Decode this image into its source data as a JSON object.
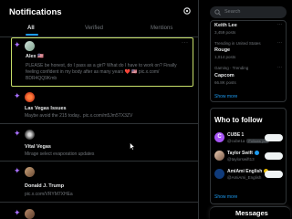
{
  "header": {
    "title": "Notifications"
  },
  "tabs": [
    {
      "label": "All"
    },
    {
      "label": "Verified"
    },
    {
      "label": "Mentions"
    }
  ],
  "notifications": [
    {
      "name": "Alex 🇺🇸",
      "text_line1": "PLEASE be honest, do I pass as a girl? What do I have to work on? Finally",
      "text_line2": "feeling confident in my body after as many years ❤️ 🇺🇸 pic.x.com/",
      "text_line3": "BDR4QQ9Kmb"
    },
    {
      "name": "Las Vegas Issues",
      "text_line1": "Maybe avoid the 215 today.. pic.x.com/m5Jm5TX3ZV"
    },
    {
      "name": "Vital Vegas",
      "text_line1": "Mirage select evaporation updates"
    },
    {
      "name": "Donald J. Trump",
      "text_line1": "pic.x.com/VRYM7XHEa"
    }
  ],
  "search": {
    "placeholder": "Search"
  },
  "trends": [
    {
      "name": "Keith Lee",
      "meta": "3,459 posts"
    },
    {
      "meta": "Trending in United States",
      "name": "Rouge",
      "meta2": "1,014 posts"
    },
    {
      "meta": "Gaming · Trending",
      "name": "Capcom",
      "meta2": "66.8K posts"
    }
  ],
  "trends_show_more": "Show more",
  "who_to_follow": {
    "title": "Who to follow",
    "accounts": [
      {
        "name": "CUBE 1",
        "handle": "@cube1a",
        "follows_you": "Follows you"
      },
      {
        "name": "Taylor Swift",
        "handle": "@taylorswift13"
      },
      {
        "name": "AmiAmi English",
        "handle": "@AmiAmi_English"
      }
    ],
    "show_more": "Show more"
  },
  "messages": {
    "label": "Messages"
  },
  "colors": {
    "accent": "#1d9bf0",
    "sparkle": "#a970ff",
    "selection": "#c8e06a",
    "background": "#000000"
  }
}
